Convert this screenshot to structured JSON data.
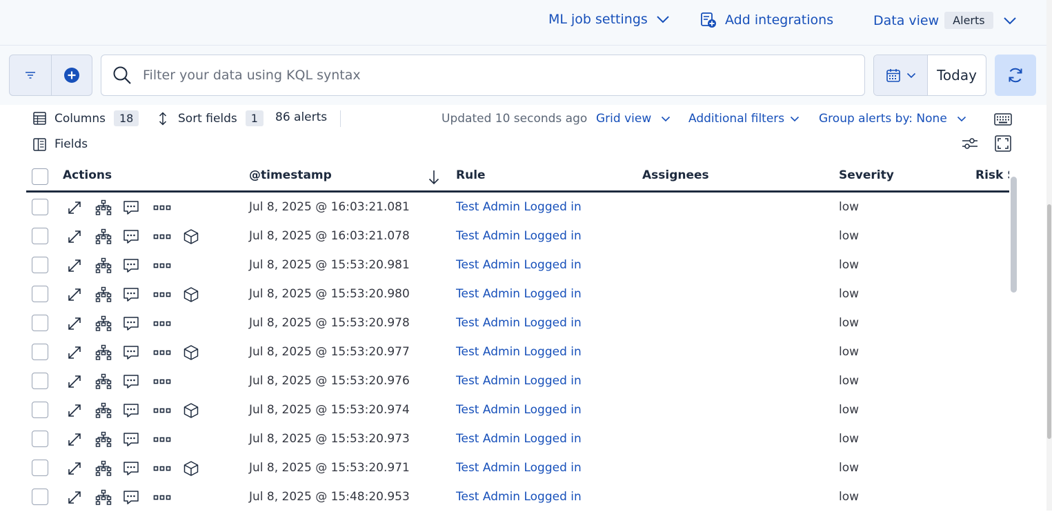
{
  "header": {
    "ml_job_settings": "ML job settings",
    "add_integrations": "Add integrations",
    "data_view_label": "Data view",
    "data_view_value": "Alerts"
  },
  "query": {
    "placeholder": "Filter your data using KQL syntax",
    "date_label": "Today"
  },
  "toolbar": {
    "columns_label": "Columns",
    "columns_count": "18",
    "sort_label": "Sort fields",
    "sort_count": "1",
    "alerts_count": "86 alerts",
    "updated": "Updated 10 seconds ago",
    "grid_view": "Grid view",
    "additional_filters": "Additional filters",
    "group_by": "Group alerts by: None",
    "fields_label": "Fields"
  },
  "table": {
    "headers": {
      "actions": "Actions",
      "timestamp": "@timestamp",
      "rule": "Rule",
      "assignees": "Assignees",
      "severity": "Severity",
      "risk": "Risk S"
    },
    "rows": [
      {
        "timestamp": "Jul 8, 2025 @ 16:03:21.081",
        "rule": "Test Admin Logged in",
        "severity": "low",
        "cube": false
      },
      {
        "timestamp": "Jul 8, 2025 @ 16:03:21.078",
        "rule": "Test Admin Logged in",
        "severity": "low",
        "cube": true
      },
      {
        "timestamp": "Jul 8, 2025 @ 15:53:20.981",
        "rule": "Test Admin Logged in",
        "severity": "low",
        "cube": false
      },
      {
        "timestamp": "Jul 8, 2025 @ 15:53:20.980",
        "rule": "Test Admin Logged in",
        "severity": "low",
        "cube": true
      },
      {
        "timestamp": "Jul 8, 2025 @ 15:53:20.978",
        "rule": "Test Admin Logged in",
        "severity": "low",
        "cube": false
      },
      {
        "timestamp": "Jul 8, 2025 @ 15:53:20.977",
        "rule": "Test Admin Logged in",
        "severity": "low",
        "cube": true
      },
      {
        "timestamp": "Jul 8, 2025 @ 15:53:20.976",
        "rule": "Test Admin Logged in",
        "severity": "low",
        "cube": false
      },
      {
        "timestamp": "Jul 8, 2025 @ 15:53:20.974",
        "rule": "Test Admin Logged in",
        "severity": "low",
        "cube": true
      },
      {
        "timestamp": "Jul 8, 2025 @ 15:53:20.973",
        "rule": "Test Admin Logged in",
        "severity": "low",
        "cube": false
      },
      {
        "timestamp": "Jul 8, 2025 @ 15:53:20.971",
        "rule": "Test Admin Logged in",
        "severity": "low",
        "cube": true
      },
      {
        "timestamp": "Jul 8, 2025 @ 15:48:20.953",
        "rule": "Test Admin Logged in",
        "severity": "low",
        "cube": false
      }
    ]
  },
  "icons": {
    "row_actions": [
      "expand-icon",
      "analyze-tree-icon",
      "comment-icon",
      "more-actions-icon",
      "session-cube-icon"
    ]
  },
  "colors": {
    "link": "#1750ba",
    "text": "#1d2a3e",
    "header_bg": "#f6f9fc",
    "refresh_bg": "#cfe0fb"
  }
}
